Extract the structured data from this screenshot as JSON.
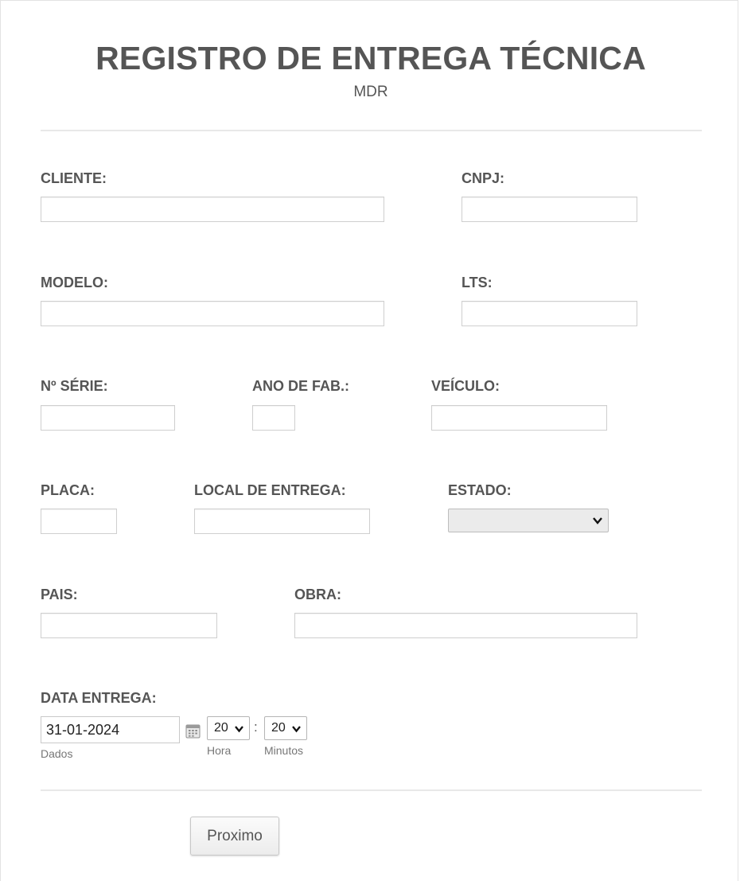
{
  "header": {
    "title": "REGISTRO DE ENTREGA TÉCNICA",
    "subtitle": "MDR"
  },
  "form": {
    "cliente": {
      "label": "CLIENTE:",
      "value": ""
    },
    "cnpj": {
      "label": "CNPJ:",
      "value": ""
    },
    "modelo": {
      "label": "MODELO:",
      "value": ""
    },
    "lts": {
      "label": "LTS:",
      "value": ""
    },
    "serie": {
      "label": "Nº SÉRIE:",
      "value": ""
    },
    "ano_fab": {
      "label": "ANO DE FAB.:",
      "value": ""
    },
    "veiculo": {
      "label": "VEÍCULO:",
      "value": ""
    },
    "placa": {
      "label": "PLACA:",
      "value": ""
    },
    "local_entrega": {
      "label": "LOCAL DE ENTREGA:",
      "value": ""
    },
    "estado": {
      "label": "ESTADO:",
      "selected": ""
    },
    "pais": {
      "label": "PAIS:",
      "value": ""
    },
    "obra": {
      "label": "OBRA:",
      "value": ""
    },
    "data_entrega": {
      "label": "DATA ENTREGA:",
      "date_value": "31-01-2024",
      "date_sublabel": "Dados",
      "hour_value": "20",
      "hour_sublabel": "Hora",
      "separator": ":",
      "minute_value": "20",
      "minute_sublabel": "Minutos",
      "calendar_icon": "calendar-icon"
    }
  },
  "actions": {
    "next_label": "Proximo"
  }
}
